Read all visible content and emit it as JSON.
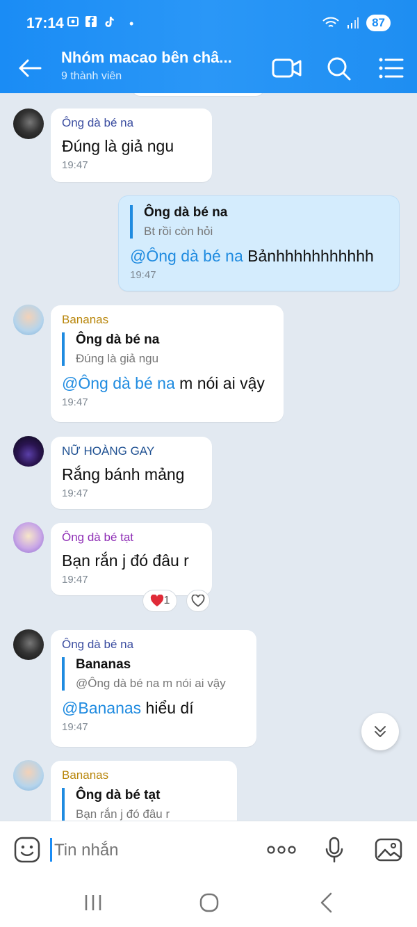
{
  "status": {
    "time": "17:14",
    "battery": "87"
  },
  "header": {
    "title": "Nhóm macao bên châ...",
    "subtitle": "9 thành viên"
  },
  "messages": [
    {
      "sender": "Ông dà bé na",
      "text": "Đúng là giả ngu",
      "time": "19:47"
    },
    {
      "quote_name": "Ông dà bé na",
      "quote_text": "Bt rồi còn hỏi",
      "mention": "@Ông dà bé na",
      "text": " Bảnhhhhhhhhhhh",
      "time": "19:47"
    },
    {
      "sender": "Bananas",
      "quote_name": "Ông dà bé na",
      "quote_text": "Đúng là giả ngu",
      "mention": "@Ông dà bé na",
      "text": " m nói ai vậy",
      "time": "19:47"
    },
    {
      "sender": "NỮ HOÀNG GAY",
      "text": "Rắng bánh mảng",
      "time": "19:47"
    },
    {
      "sender": "Ông dà bé tạt",
      "text": "Bạn rắn j đó đâu r",
      "time": "19:47",
      "reaction_count": "1"
    },
    {
      "sender": "Ông dà bé na",
      "quote_name": "Bananas",
      "quote_text": "@Ông dà bé na m nói ai vậy",
      "mention": "@Bananas",
      "text": " hiểu dí",
      "time": "19:47"
    },
    {
      "sender": "Bananas",
      "quote_name": "Ông dà bé tạt",
      "quote_text": "Bạn rắn j đó đâu r"
    }
  ],
  "input": {
    "placeholder": "Tin nhắn"
  },
  "colors": {
    "header": "#1a8cf5",
    "mention": "#1f8be0",
    "bananas": "#b8860b",
    "na": "#3b4da0",
    "tat": "#8e2db5",
    "gay": "#1d4f91"
  }
}
